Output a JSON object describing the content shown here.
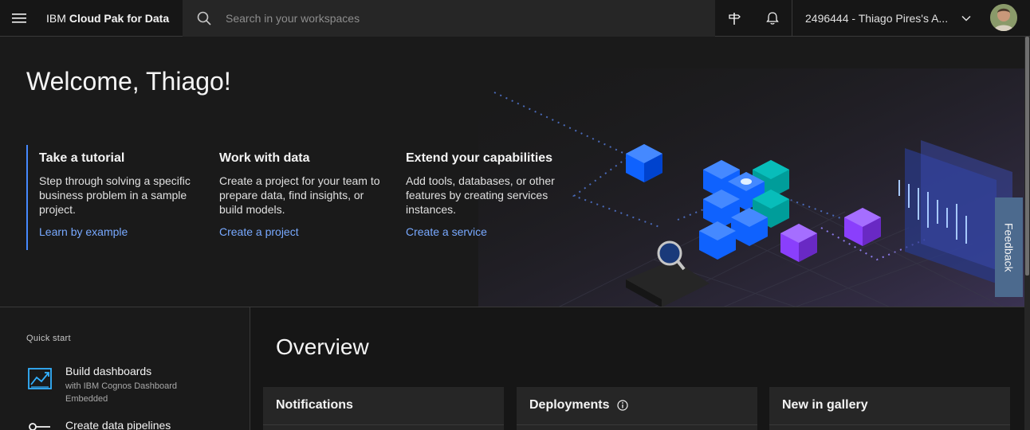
{
  "header": {
    "brand_prefix": "IBM",
    "brand_name": "Cloud Pak for Data",
    "search_placeholder": "Search in your workspaces",
    "account_label": "2496444 - Thiago Pires's A...",
    "icons": [
      "menu-icon",
      "search-icon",
      "signpost-icon",
      "notification-icon",
      "chevron-down-icon"
    ]
  },
  "hero": {
    "welcome": "Welcome, Thiago!",
    "columns": [
      {
        "title": "Take a tutorial",
        "text": "Step through solving a specific business problem in a sample project.",
        "link": "Learn by example"
      },
      {
        "title": "Work with data",
        "text": "Create a project for your team to prepare data, find insights, or build models.",
        "link": "Create a project"
      },
      {
        "title": "Extend your capabilities",
        "text": "Add tools, databases, or other features by creating services instances.",
        "link": "Create a service"
      }
    ]
  },
  "feedback": {
    "label": "Feedback"
  },
  "quick_start": {
    "title": "Quick start",
    "items": [
      {
        "title": "Build dashboards",
        "subtitle": "with IBM Cognos Dashboard Embedded",
        "icon": "dashboard-chart-icon"
      },
      {
        "title": "Create data pipelines",
        "subtitle": "",
        "icon": "pipeline-icon"
      }
    ]
  },
  "overview": {
    "title": "Overview",
    "cards": [
      {
        "title": "Notifications"
      },
      {
        "title": "Deployments"
      },
      {
        "title": "New in gallery"
      }
    ]
  },
  "colors": {
    "background": "#161616",
    "link": "#78a9ff",
    "accent": "#4589ff",
    "feedback": "#4c6a8e"
  }
}
